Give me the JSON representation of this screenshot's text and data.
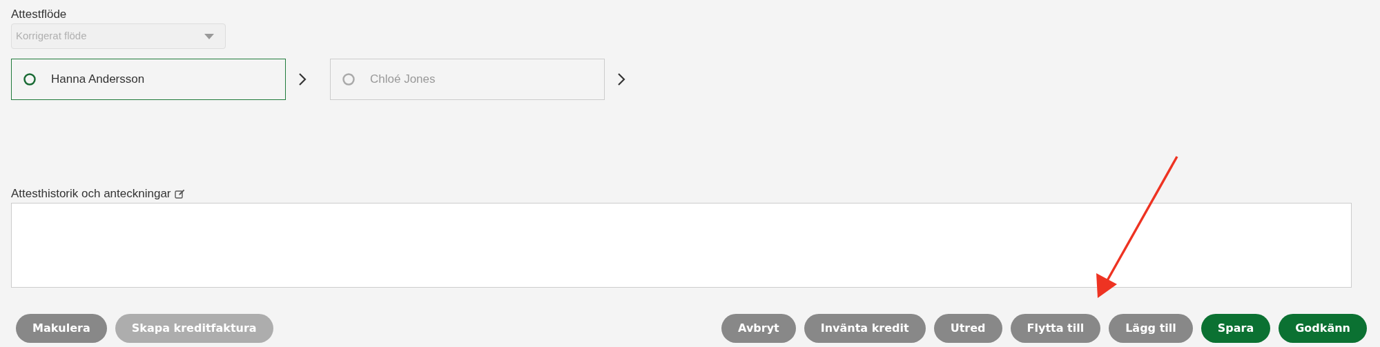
{
  "flow": {
    "label": "Attestflöde",
    "dropdown": {
      "value": "Korrigerat flöde",
      "disabled": true
    },
    "steps": [
      {
        "name": "Hanna Andersson",
        "selected": true
      },
      {
        "name": "Chloé Jones",
        "selected": false
      }
    ]
  },
  "notes": {
    "label": "Attesthistorik och anteckningar"
  },
  "left_buttons": [
    {
      "label": "Makulera",
      "kind": "secondary"
    },
    {
      "label": "Skapa kreditfaktura",
      "kind": "disabled"
    }
  ],
  "right_buttons": [
    {
      "label": "Avbryt",
      "kind": "secondary"
    },
    {
      "label": "Invänta kredit",
      "kind": "secondary"
    },
    {
      "label": "Utred",
      "kind": "secondary"
    },
    {
      "label": "Flytta till",
      "kind": "secondary"
    },
    {
      "label": "Lägg till",
      "kind": "secondary"
    },
    {
      "label": "Spara",
      "kind": "primary"
    },
    {
      "label": "Godkänn",
      "kind": "primary"
    }
  ]
}
